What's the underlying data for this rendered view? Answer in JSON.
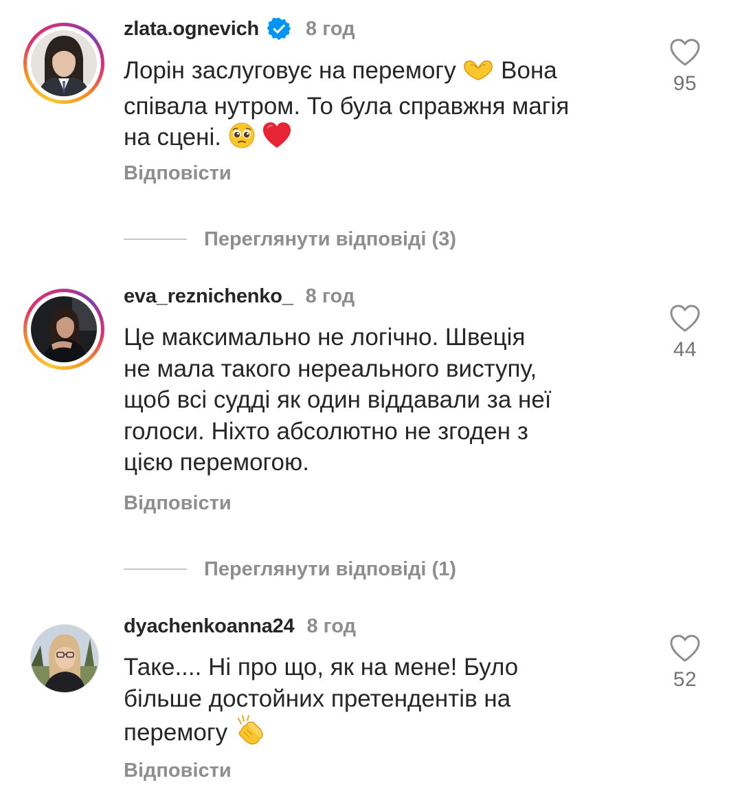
{
  "comments": [
    {
      "username": "zlata.ognevich",
      "verified": true,
      "time": "8 год",
      "lines": [
        "Лорін заслуговує на перемогу",
        "співала нутром. То була справжня магія",
        "на сцені."
      ],
      "line1_tail": "Вона",
      "emojis": [
        "heart-hands-emoji",
        "pleading-face-emoji",
        "red-heart-emoji"
      ],
      "likes": "95",
      "reply_label": "Відповісти",
      "view_replies": "Переглянути відповіді (3)"
    },
    {
      "username": "eva_reznichenko_",
      "verified": false,
      "time": "8 год",
      "lines": [
        "Це максимально не логічно.  Швеція",
        "не мала такого нереального виступу,",
        "щоб всі судді як один віддавали за неї",
        "голоси. Ніхто абсолютно не згоден з",
        "цією перемогою."
      ],
      "likes": "44",
      "reply_label": "Відповісти",
      "view_replies": "Переглянути відповіді (1)"
    },
    {
      "username": "dyachenkoanna24",
      "verified": false,
      "time": "8 год",
      "lines": [
        "Таке.... Ні про що, як на мене! Було",
        "більше достойних претендентів на",
        "перемогу"
      ],
      "emojis": [
        "clapping-hands-emoji"
      ],
      "likes": "52",
      "reply_label": "Відповісти"
    }
  ],
  "colors": {
    "text": "#262626",
    "muted": "#8e8e8e",
    "verified_blue": "#0095f6",
    "heart_red": "#ed4956"
  }
}
